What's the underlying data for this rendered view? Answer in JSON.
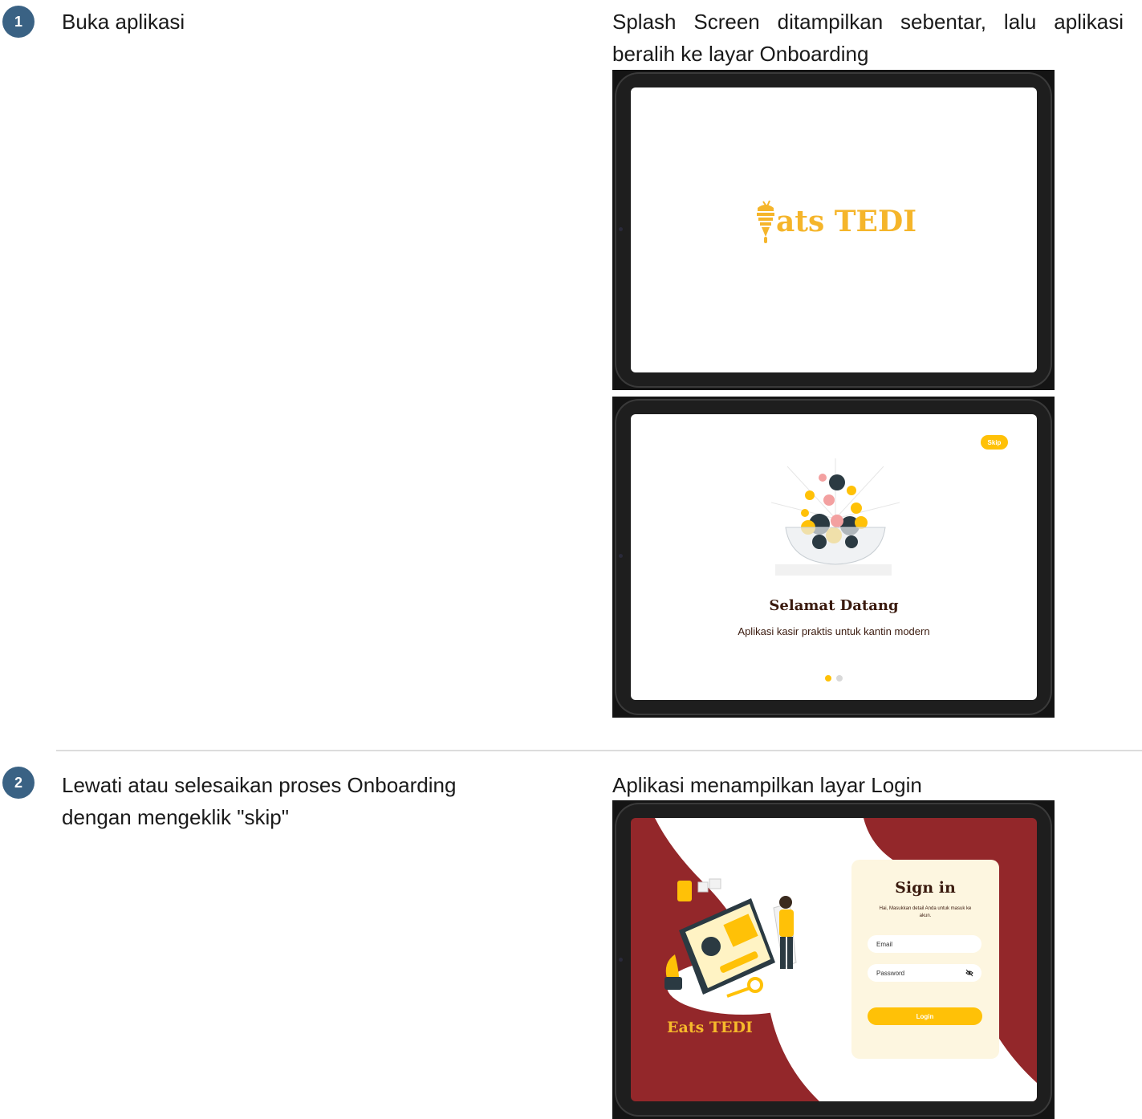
{
  "steps": [
    {
      "number": "1",
      "action": "Buka aplikasi",
      "result_line1": "Splash Screen ditampilkan sebentar, lalu aplikasi",
      "result_line2": "beralih ke layar Onboarding"
    },
    {
      "number": "2",
      "action_line1": "Lewati atau selesaikan proses Onboarding",
      "action_line2": "dengan mengeklik \"skip\"",
      "result": "Aplikasi menampilkan layar Login"
    }
  ],
  "splash": {
    "logo_text": "ats TEDI",
    "logo_icon": "ice-cream-e-icon"
  },
  "onboarding": {
    "skip_label": "Skip",
    "title": "Selamat Datang",
    "subtitle": "Aplikasi kasir praktis untuk kantin modern",
    "pages_total": 2,
    "current_page": 1,
    "illustration": "salad-bowl-illustration"
  },
  "login": {
    "brand": "Eats TEDI",
    "title": "Sign in",
    "subtitle": "Hai, Masukkan detail Anda untuk masuk ke akun.",
    "email_placeholder": "Email",
    "password_placeholder": "Password",
    "button_label": "Login",
    "illustration": "sign-in-tablet-illustration"
  },
  "colors": {
    "step_badge": "#3a6284",
    "accent": "#ffc107",
    "logo": "#f5b52a",
    "login_bg": "#93272a",
    "card_bg": "#fdf6e0"
  }
}
